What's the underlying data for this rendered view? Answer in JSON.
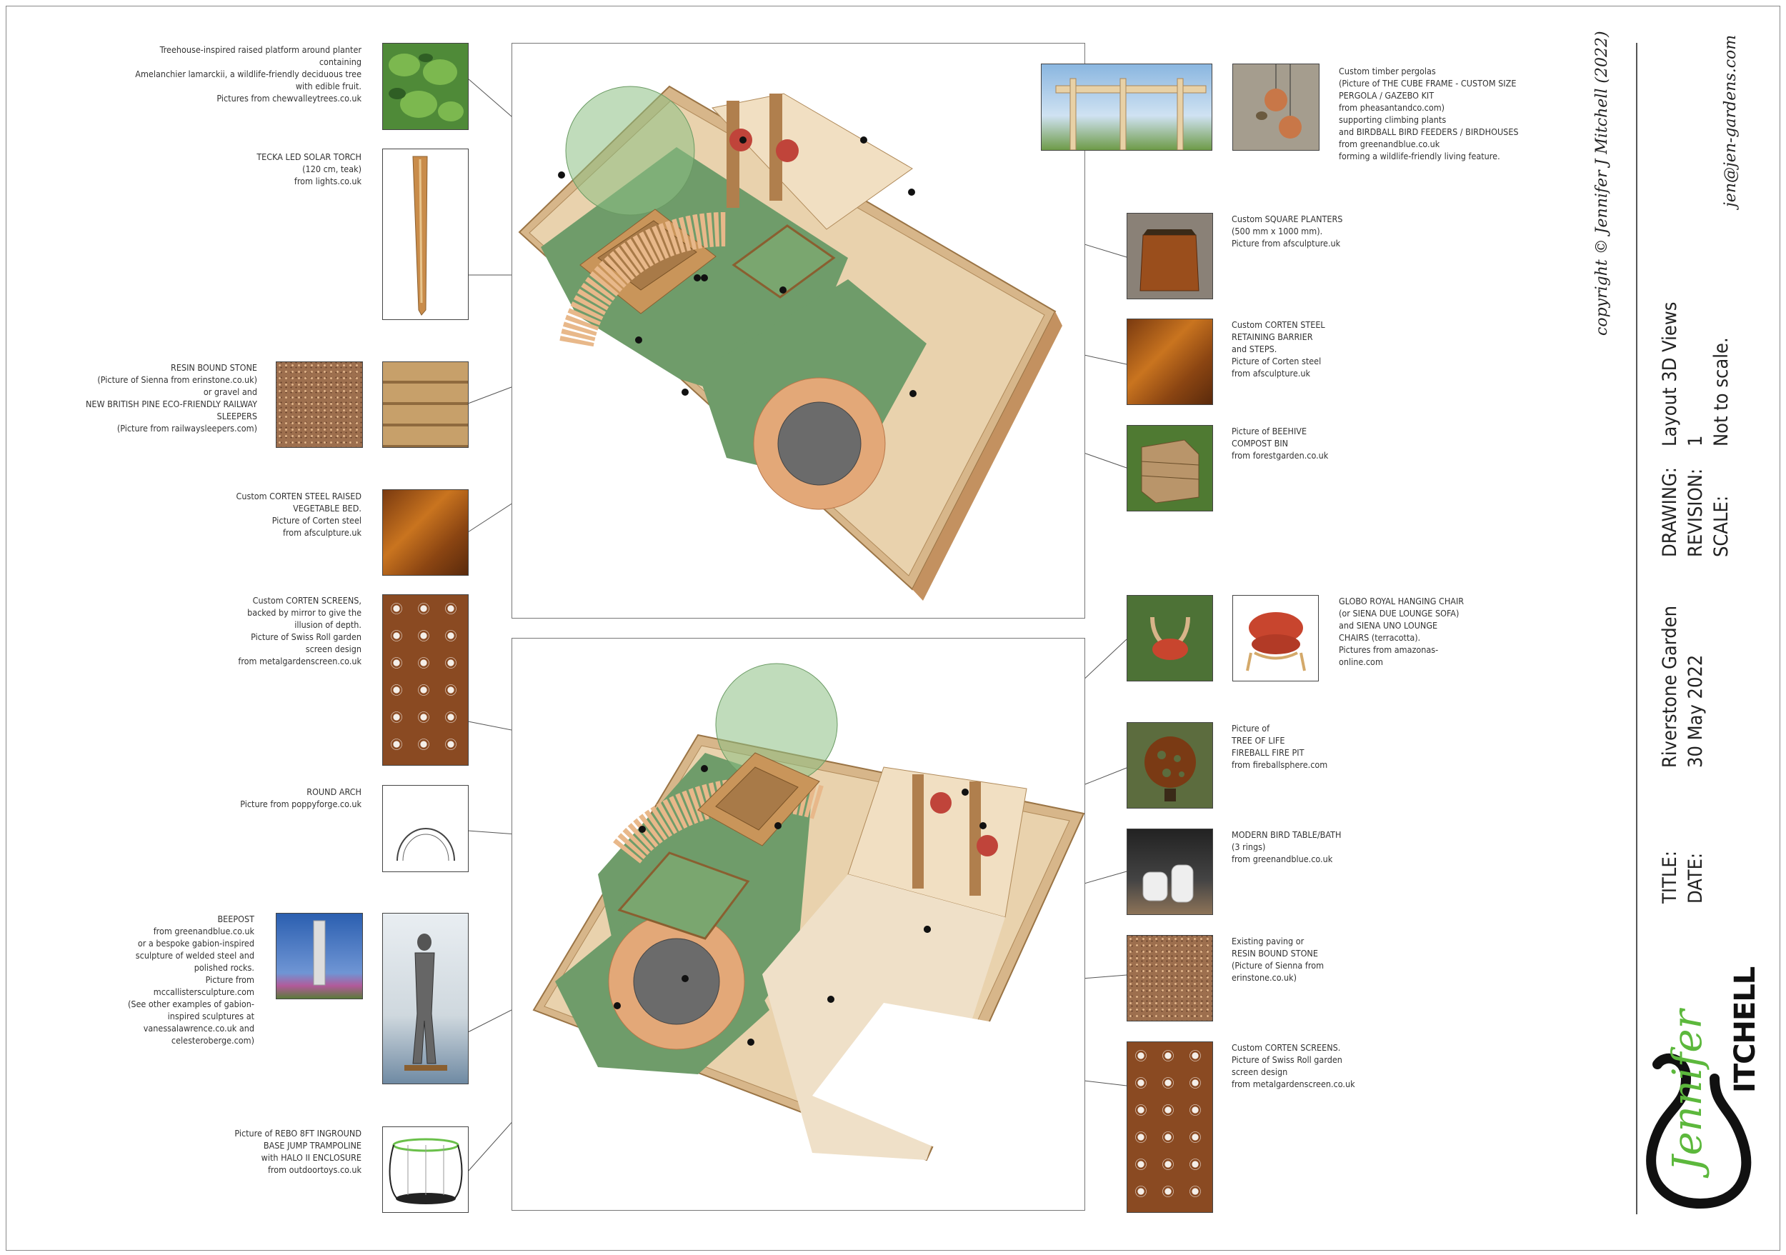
{
  "notes": {
    "treehouse": "Treehouse-inspired raised platform around planter\ncontaining\nAmelanchier lamarckii, a wildlife-friendly deciduous tree\nwith edible fruit.\nPictures from chewvalleytrees.co.uk",
    "torch": "TECKA LED SOLAR TORCH\n(120 cm, teak)\nfrom lights.co.uk",
    "resin": "RESIN BOUND STONE\n(Picture of Sienna from erinstone.co.uk)\nor gravel and\nNEW BRITISH PINE ECO-FRIENDLY RAILWAY\nSLEEPERS\n(Picture from railwaysleepers.com)",
    "vegbed": "Custom CORTEN STEEL RAISED\nVEGETABLE BED.\nPicture of Corten steel\nfrom afsculpture.uk",
    "screens_left": "Custom CORTEN SCREENS,\nbacked by mirror to give the\nillusion of depth.\nPicture of Swiss Roll garden\nscreen design\nfrom metalgardenscreen.co.uk",
    "arch": "ROUND ARCH\nPicture from poppyforge.co.uk",
    "beepost": "BEEPOST\nfrom greenandblue.co.uk\nor a bespoke gabion-inspired\nsculpture of welded steel and\npolished rocks.\nPicture from\nmccallistersculpture.com\n(See other examples of gabion-\ninspired sculptures at\nvanessalawrence.co.uk and\ncelesteroberge.com)",
    "trampoline": "Picture of REBO 8FT INGROUND\nBASE JUMP TRAMPOLINE\nwith HALO II ENCLOSURE\nfrom outdoortoys.co.uk",
    "pergola": "Custom timber pergolas\n(Picture of THE CUBE FRAME - CUSTOM SIZE\nPERGOLA / GAZEBO KIT\nfrom pheasantandco.com)\nsupporting climbing plants\nand BIRDBALL BIRD FEEDERS / BIRDHOUSES\nfrom greenandblue.co.uk\nforming a wildlife-friendly living feature.",
    "planters": "Custom SQUARE PLANTERS\n(500 mm x 1000 mm).\nPicture from afsculpture.uk",
    "retaining": "Custom CORTEN STEEL\nRETAINING BARRIER\nand STEPS.\nPicture of Corten steel\nfrom afsculpture.uk",
    "compost": "Picture of BEEHIVE\nCOMPOST BIN\nfrom forestgarden.co.uk",
    "chair": "GLOBO ROYAL HANGING CHAIR\n(or SIENA DUE LOUNGE SOFA)\nand SIENA UNO LOUNGE\nCHAIRS (terracotta).\nPictures from amazonas-\nonline.com",
    "firepit": "Picture of\nTREE OF LIFE\nFIREBALL FIRE PIT\nfrom fireballsphere.com",
    "birdtable": "MODERN BIRD TABLE/BATH\n(3 rings)\nfrom greenandblue.co.uk",
    "paving": "Existing paving or\nRESIN BOUND STONE\n(Picture of Sienna from\nerinstone.co.uk)",
    "screens_right": "Custom CORTEN SCREENS.\nPicture of Swiss Roll garden\nscreen design\nfrom metalgardenscreen.co.uk"
  },
  "title_block": {
    "copyright": "copyright © Jennifer J Mitchell (2022)",
    "email": "jen@jen-gardens.com",
    "drawing_label": "DRAWING:",
    "drawing_value": "Layout 3D Views",
    "revision_label": "REVISION:",
    "revision_value": "1",
    "scale_label": "SCALE:",
    "scale_value": "Not to scale.",
    "title_label": "TITLE:",
    "title_value": "Riverstone Garden",
    "date_label": "DATE:",
    "date_value": "30 May 2022",
    "logo_script": "Jennifer",
    "logo_caps": "ITCHELL"
  },
  "colors": {
    "timber": "#c9955a",
    "lawn": "#6f9c6a",
    "paving": "#efd9b8",
    "corten": "#9b5a22",
    "logo_green": "#5cb83c"
  }
}
